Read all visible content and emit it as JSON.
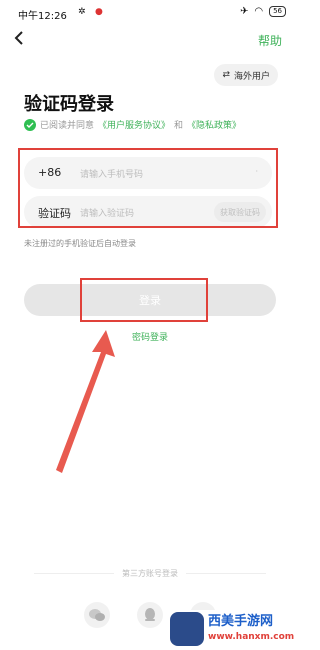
{
  "status_bar": {
    "time": "中午12:26",
    "notification_icons": [
      "fan-icon",
      "app-icon"
    ],
    "battery": "56"
  },
  "header": {
    "help_label": "帮助"
  },
  "overseas_button": {
    "label": "海外用户"
  },
  "page_title": "验证码登录",
  "agreement": {
    "prefix": "已阅读并同意",
    "service_link": "《用户服务协议》",
    "and": "和",
    "privacy_link": "《隐私政策》"
  },
  "phone_field": {
    "country_code": "+86",
    "placeholder": "请输入手机号码"
  },
  "code_field": {
    "label": "验证码",
    "placeholder": "请输入验证码",
    "get_code_label": "获取验证码"
  },
  "auto_register_hint": "未注册过的手机验证后自动登录",
  "login_button_label": "登录",
  "password_login_label": "密码登录",
  "third_party_label": "第三方账号登录",
  "social_icons": [
    "wechat-icon",
    "qq-icon",
    "weibo-icon"
  ],
  "watermark": {
    "title": "西美手游网",
    "url": "www.hanxm.com"
  },
  "colors": {
    "accent_green": "#3fb25a",
    "annotation_red": "#e0413a"
  }
}
